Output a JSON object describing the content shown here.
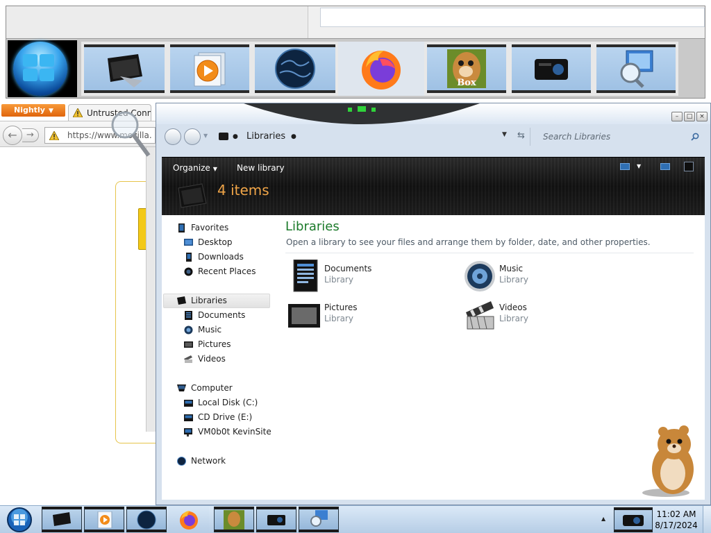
{
  "browser": {
    "menu_button": "Nightly",
    "tab_title": "Untrusted Conne",
    "url": "https://www.mozilla."
  },
  "explorer": {
    "breadcrumb": "Libraries",
    "search_placeholder": "Search Libraries",
    "toolbar": {
      "organize": "Organize",
      "new_library": "New library"
    },
    "item_count": "4 items",
    "nav_pane": {
      "favorites": {
        "label": "Favorites",
        "items": [
          "Desktop",
          "Downloads",
          "Recent Places"
        ]
      },
      "libraries": {
        "label": "Libraries",
        "items": [
          "Documents",
          "Music",
          "Pictures",
          "Videos"
        ]
      },
      "computer": {
        "label": "Computer",
        "items": [
          "Local Disk (C:)",
          "CD Drive (E:)",
          "VM0b0t KevinSite"
        ]
      },
      "network": {
        "label": "Network"
      }
    },
    "main": {
      "heading": "Libraries",
      "description": "Open a library to see your files and arrange them by folder, date, and other properties.",
      "libraries": [
        {
          "name": "Documents",
          "type": "Library",
          "icon": "documents-library-icon"
        },
        {
          "name": "Music",
          "type": "Library",
          "icon": "music-library-icon"
        },
        {
          "name": "Pictures",
          "type": "Library",
          "icon": "pictures-library-icon"
        },
        {
          "name": "Videos",
          "type": "Library",
          "icon": "videos-library-icon"
        }
      ]
    }
  },
  "taskbar": {
    "time": "11:02 AM",
    "date": "8/17/2024"
  },
  "dock_tile_text": "Box",
  "colors": {
    "accent_green": "#1b7a2a",
    "item_count_orange": "#f0a548",
    "nightly_orange": "#e0640c"
  }
}
